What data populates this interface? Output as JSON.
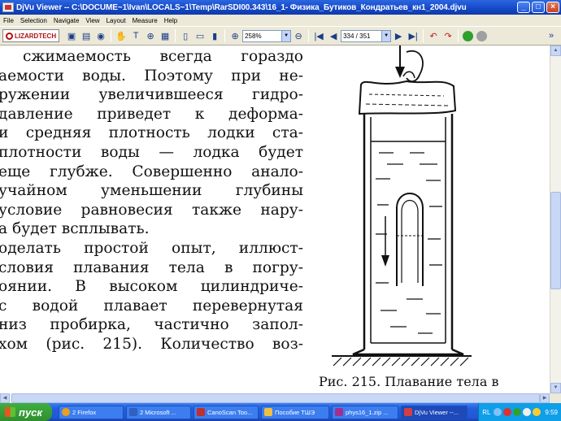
{
  "window": {
    "title": "DjVu Viewer -- C:\\DOCUME~1\\Ivan\\LOCALS~1\\Temp\\RarSDI00.343\\16_1- Физика_Бутиков_Кондратьев_кн1_2004.djvu",
    "minimize": "_",
    "maximize": "□",
    "close": "×"
  },
  "menu": [
    "File",
    "Selection",
    "Navigate",
    "View",
    "Layout",
    "Measure",
    "Help"
  ],
  "toolbar": {
    "logo": "LIZARDTECH",
    "zoom": "258%",
    "page": "334 / 351"
  },
  "document": {
    "lines": [
      "сжимаемость всегда гораздо",
      "аемости воды. Поэтому при не-",
      "ружении увеличившееся гидро-",
      "давление приведет к деформа-",
      "и средняя плотность лодки ста-",
      "плотности воды — лодка будет",
      "еще глубже. Совершенно анало-",
      "учайном уменьшении глубины",
      "условие равновесия также нару-",
      "а будет всплывать.",
      "оделать простой опыт, иллюст-",
      "словия плавания тела в погру-",
      "оянии. В высоком цилиндриче-",
      "с водой плавает перевернутая",
      "низ пробирка, частично запол-",
      "хом (рис. 215). Количество воз-"
    ],
    "caption": "Рис. 215. Плавание тела в"
  },
  "taskbar": {
    "start": "пуск",
    "tasks": [
      {
        "label": "2 Firefox",
        "color": "#e8a020"
      },
      {
        "label": "2 Microsoft ...",
        "color": "#3060c0"
      },
      {
        "label": "CanoScan Too...",
        "color": "#c03030"
      },
      {
        "label": "Пособие ТШЭ",
        "color": "#f0c040"
      },
      {
        "label": "phys16_1.zip ...",
        "color": "#a03090"
      },
      {
        "label": "DjVu Viewer --...",
        "color": "#3c3c9c"
      }
    ],
    "lang": "RL",
    "clock": "9:59"
  }
}
